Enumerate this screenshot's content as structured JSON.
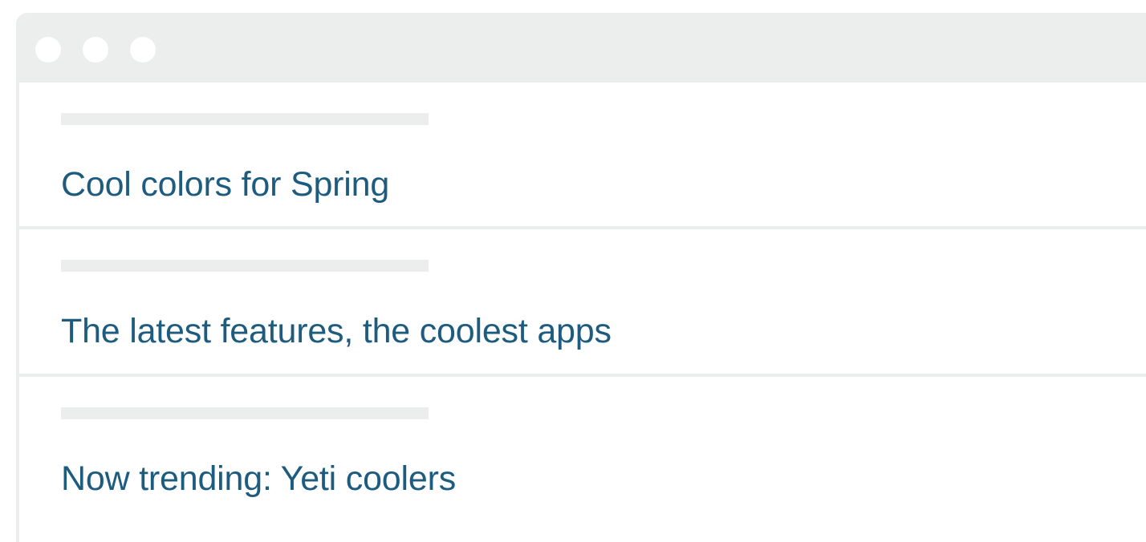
{
  "window": {
    "controls": [
      "window-dot",
      "window-dot",
      "window-dot"
    ]
  },
  "feed": {
    "items": [
      {
        "headline": "Cool colors for Spring"
      },
      {
        "headline": "The latest features, the coolest apps"
      },
      {
        "headline": "Now trending: Yeti coolers"
      }
    ]
  },
  "colors": {
    "headline": "#1d5c7e",
    "chrome": "#eceeee",
    "background": "#ffffff"
  }
}
